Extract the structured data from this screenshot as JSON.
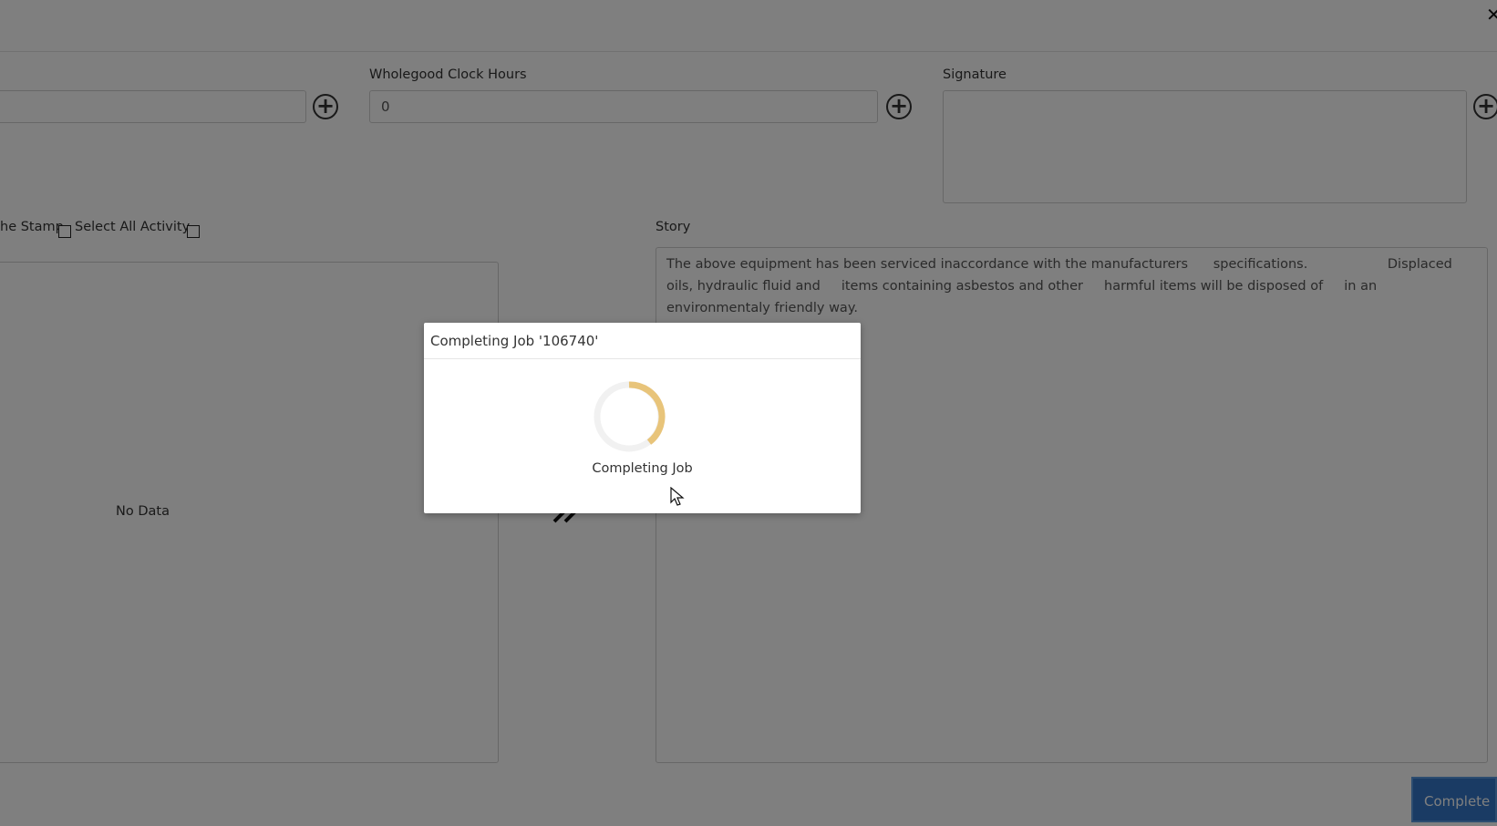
{
  "form": {
    "close_icon": "close-icon",
    "clock_hours": {
      "label": "Wholegood Clock Hours",
      "value": "0"
    },
    "signature": {
      "label": "Signature"
    },
    "checkboxes": {
      "time_stamp_label": "he Stamp",
      "select_all_label": "Select All Activity"
    },
    "story": {
      "label": "Story",
      "text": "The above equipment has been serviced inaccordance with the manufacturers      specifications.                   Displaced oils, hydraulic fluid and     items containing asbestos and other     harmful items will be disposed of     in an environmentaly friendly way."
    },
    "activity_panel": {
      "empty_text": "No Data"
    },
    "complete_button": {
      "label": "Complete"
    }
  },
  "modal": {
    "title": "Completing Job '106740'",
    "message": "Completing Job",
    "spinner_color": "#e8c47a"
  },
  "colors": {
    "overlay": "#000000",
    "accent": "#3477c8"
  }
}
